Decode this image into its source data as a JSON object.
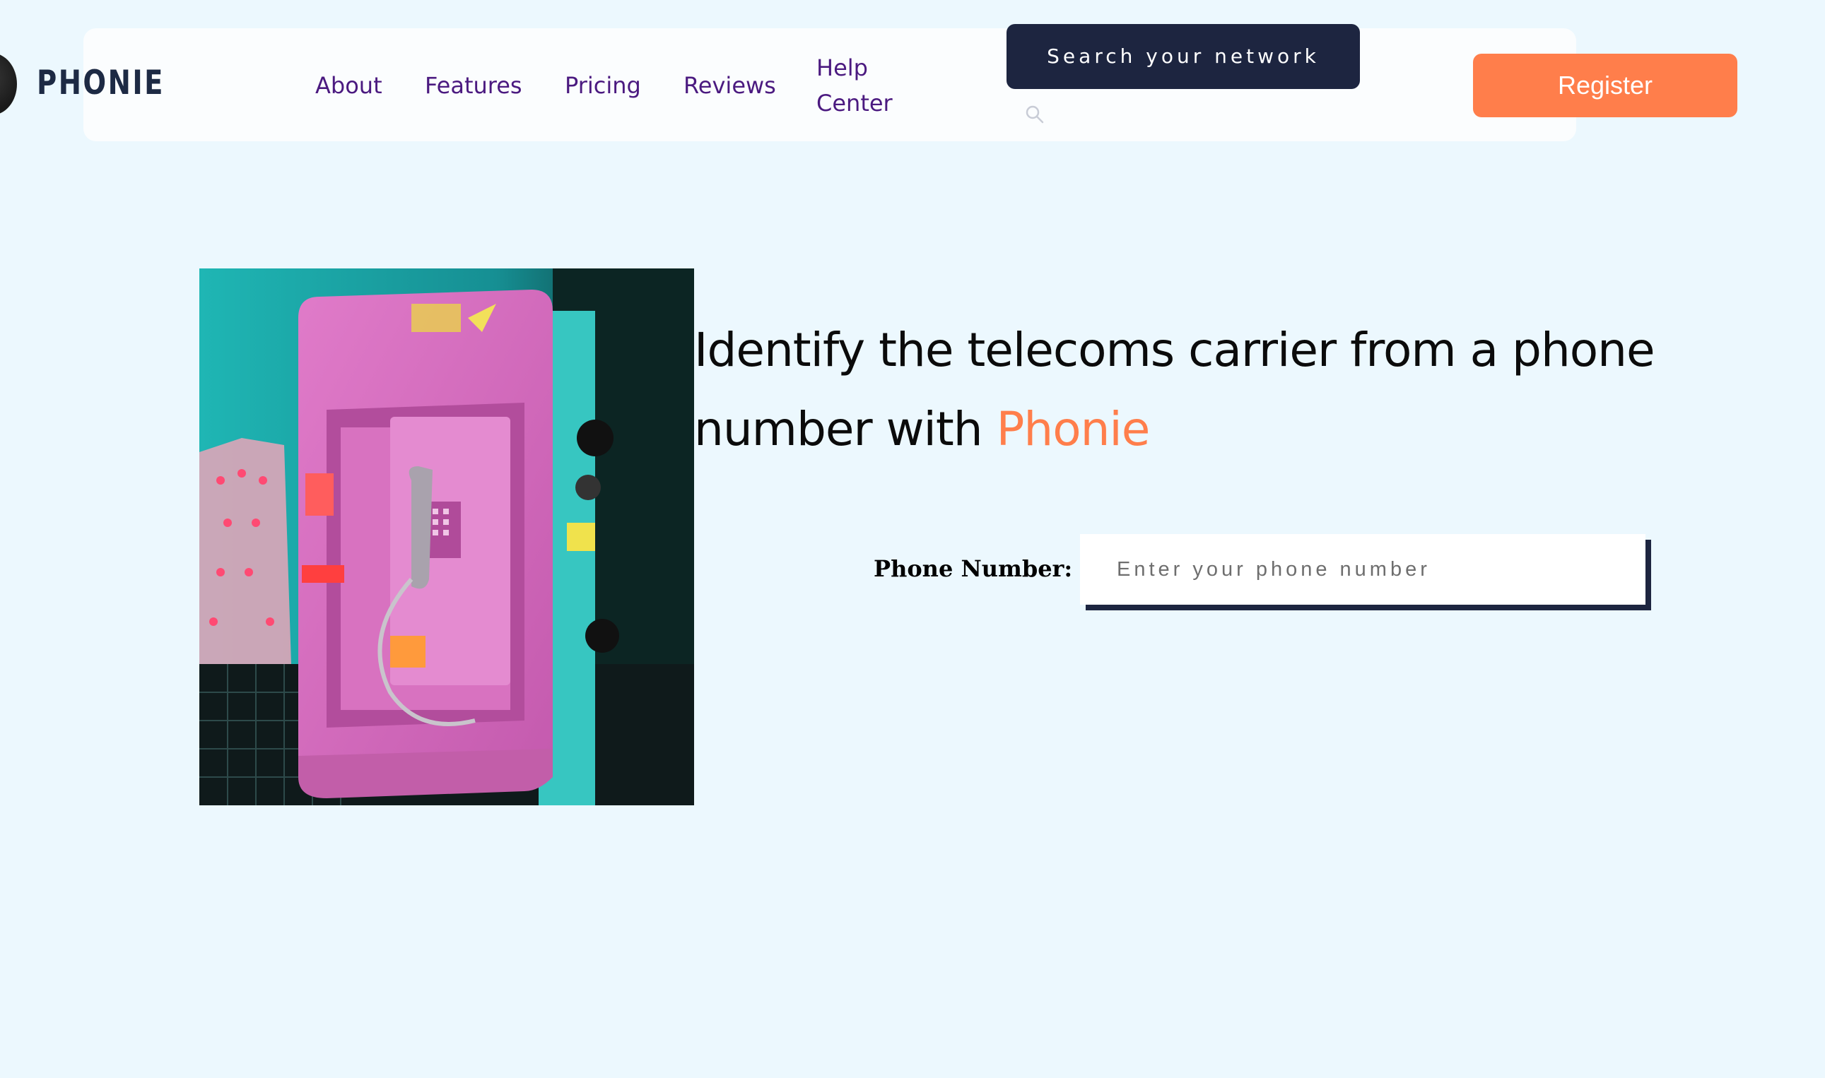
{
  "header": {
    "logo_text": "PHONIE",
    "nav": [
      {
        "label": "About"
      },
      {
        "label": "Features"
      },
      {
        "label": "Pricing"
      },
      {
        "label": "Reviews"
      },
      {
        "label": "Help Center"
      }
    ],
    "search_button_label": "Search your network",
    "register_label": "Register"
  },
  "hero": {
    "title_main": "Identify the telecoms carrier from a phone number with ",
    "title_brand": "Phonie",
    "phone_label": "Phone Number:",
    "phone_placeholder": "Enter your phone number"
  },
  "colors": {
    "background": "#ecf8fe",
    "accent": "#ff7e4b",
    "navy": "#1d2540",
    "nav_text": "#4b1a80"
  }
}
